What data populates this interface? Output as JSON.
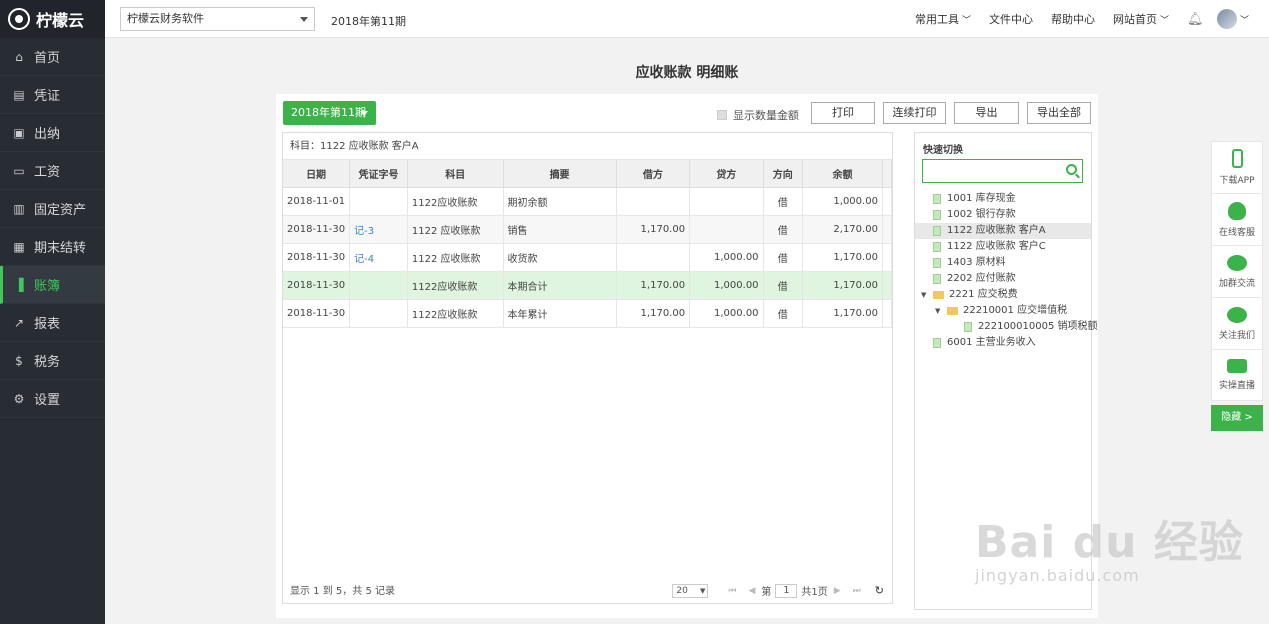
{
  "app": {
    "name": "柠檬云"
  },
  "sidebar": {
    "items": [
      {
        "label": "首页",
        "icon": "home-icon"
      },
      {
        "label": "凭证",
        "icon": "voucher-icon"
      },
      {
        "label": "出纳",
        "icon": "cashier-icon"
      },
      {
        "label": "工资",
        "icon": "salary-icon"
      },
      {
        "label": "固定资产",
        "icon": "fixed-asset-icon"
      },
      {
        "label": "期末结转",
        "icon": "calendar-icon"
      },
      {
        "label": "账簿",
        "icon": "ledger-book-icon",
        "active": true
      },
      {
        "label": "报表",
        "icon": "chart-icon"
      },
      {
        "label": "税务",
        "icon": "tax-icon"
      },
      {
        "label": "设置",
        "icon": "gear-icon"
      }
    ]
  },
  "header": {
    "company": "柠檬云财务软件",
    "period": "2018年第11期",
    "links": [
      "常用工具",
      "文件中心",
      "帮助中心",
      "网站首页"
    ]
  },
  "page": {
    "title": "应收账款 明细账",
    "period_button": "2018年第11期",
    "show_qty_label": "显示数量金额",
    "buttons": [
      "打印",
      "连续打印",
      "导出",
      "导出全部"
    ],
    "subject_line": "科目：1122 应收账款 客户A"
  },
  "table": {
    "headers": [
      "日期",
      "凭证字号",
      "科目",
      "摘要",
      "借方",
      "贷方",
      "方向",
      "余额"
    ],
    "rows": [
      [
        "2018-11-01",
        "",
        "1122应收账款",
        "期初余额",
        "",
        "",
        "借",
        "1,000.00"
      ],
      [
        "2018-11-30",
        "记-3",
        "1122 应收账款",
        "销售",
        "1,170.00",
        "",
        "借",
        "2,170.00"
      ],
      [
        "2018-11-30",
        "记-4",
        "1122 应收账款",
        "收货款",
        "",
        "1,000.00",
        "借",
        "1,170.00"
      ],
      [
        "2018-11-30",
        "",
        "1122应收账款",
        "本期合计",
        "1,170.00",
        "1,000.00",
        "借",
        "1,170.00"
      ],
      [
        "2018-11-30",
        "",
        "1122应收账款",
        "本年累计",
        "1,170.00",
        "1,000.00",
        "借",
        "1,170.00"
      ]
    ]
  },
  "footer": {
    "records": "显示 1 到 5，共 5 记录",
    "page_size": "20",
    "page_prefix": "第",
    "page_no": "1",
    "page_total": "共1页"
  },
  "quick": {
    "title": "快速切换",
    "tree": [
      {
        "label": "1001 库存现金",
        "type": "doc",
        "level": 0
      },
      {
        "label": "1002 银行存款",
        "type": "doc",
        "level": 0
      },
      {
        "label": "1122 应收账款 客户A",
        "type": "doc",
        "level": 0,
        "selected": true
      },
      {
        "label": "1122 应收账款 客户C",
        "type": "doc",
        "level": 0
      },
      {
        "label": "1403 原材料",
        "type": "doc",
        "level": 0
      },
      {
        "label": "2202 应付账款",
        "type": "doc",
        "level": 0
      },
      {
        "label": "2221 应交税费",
        "type": "folder",
        "level": 0
      },
      {
        "label": "22210001 应交增值税",
        "type": "folder",
        "level": 1
      },
      {
        "label": "222100010005 销项税额",
        "type": "doc",
        "level": 2
      },
      {
        "label": "6001 主营业务收入",
        "type": "doc",
        "level": 0
      }
    ]
  },
  "floatbar": {
    "items": [
      "下载APP",
      "在线客服",
      "加群交流",
      "关注我们",
      "实操直播"
    ],
    "hide": "隐藏 >"
  },
  "watermark": {
    "big": "Bai du 经验",
    "small": "jingyan.baidu.com"
  }
}
